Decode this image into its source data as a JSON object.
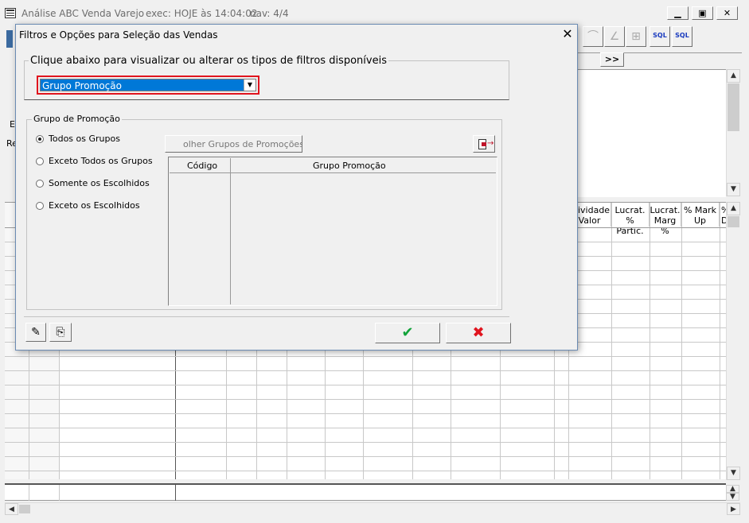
{
  "app": {
    "title": "Análise ABC Venda Varejo",
    "exec": "exec: HOJE às 14:04:02",
    "nav": "nav: 4/4",
    "min": "▭",
    "max": "▢",
    "close": "✕"
  },
  "toolbar": {
    "sql_label_1": "SQL",
    "sql_label_2": "SQL",
    "next_label": ">>"
  },
  "side_labels": {
    "e": "E",
    "re": "Re"
  },
  "grid": {
    "headers": [
      {
        "line1": "atividade",
        "line2": "Valor"
      },
      {
        "line1": "Lucrat.",
        "line2": "% Partic."
      },
      {
        "line1": "Lucrat.",
        "line2": "Marg %"
      },
      {
        "line1": "% Mark",
        "line2": "Up"
      },
      {
        "line1": "%",
        "line2": "D"
      }
    ]
  },
  "dialog": {
    "title": "Filtros e Opções para Seleção das Vendas",
    "filter_group_label": "Clique abaixo para visualizar ou alterar os tipos de filtros disponíveis",
    "filter_select_value": "Grupo Promoção",
    "promo_group_label": "Grupo de Promoção",
    "radios": [
      {
        "label": "Todos os Grupos",
        "checked": true
      },
      {
        "label": "Exceto Todos os Grupos",
        "checked": false
      },
      {
        "label": "Somente os Escolhidos",
        "checked": false
      },
      {
        "label": "Exceto os Escolhidos",
        "checked": false
      }
    ],
    "choose_button": "olher Grupos de Promoções...",
    "table_headers": {
      "code": "Código",
      "group": "Grupo Promoção"
    },
    "accent_highlight": "#e0141e",
    "select_bg": "#0078d7"
  }
}
